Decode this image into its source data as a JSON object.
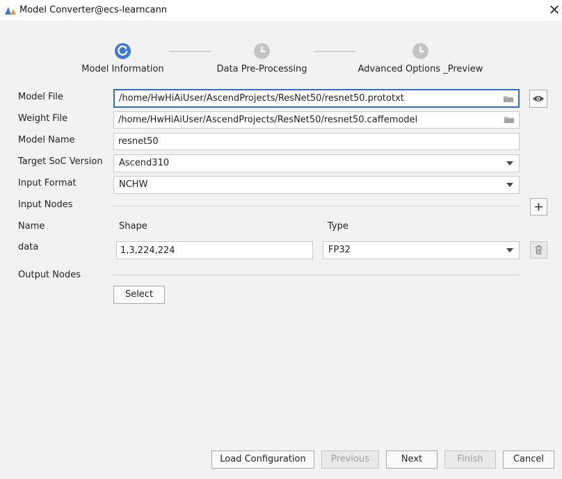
{
  "window": {
    "title": "Model Converter@ecs-learncann",
    "close_glyph": "✕"
  },
  "steps": [
    {
      "label": "Model Information",
      "state": "active"
    },
    {
      "label": "Data Pre-Processing",
      "state": "pending"
    },
    {
      "label": "Advanced Options _Preview",
      "state": "pending"
    }
  ],
  "form": {
    "model_file": {
      "label": "Model File",
      "value": "/home/HwHiAiUser/AscendProjects/ResNet50/resnet50.prototxt"
    },
    "weight_file": {
      "label": "Weight File",
      "value": "/home/HwHiAiUser/AscendProjects/ResNet50/resnet50.caffemodel"
    },
    "model_name": {
      "label": "Model Name",
      "value": "resnet50"
    },
    "target_soc": {
      "label": "Target SoC Version",
      "value": "Ascend310"
    },
    "input_format": {
      "label": "Input Format",
      "value": "NCHW"
    },
    "input_nodes": {
      "label": "Input Nodes",
      "columns": [
        "Name",
        "Shape",
        "Type"
      ],
      "rows": [
        {
          "name": "data",
          "shape": "1,3,224,224",
          "type": "FP32"
        }
      ]
    },
    "output_nodes": {
      "label": "Output Nodes",
      "select_label": "Select"
    }
  },
  "buttons": {
    "load_configuration": "Load Configuration",
    "previous": "Previous",
    "next": "Next",
    "finish": "Finish",
    "cancel": "Cancel"
  },
  "colors": {
    "accent": "#3c78d8",
    "step_pending": "#c4c4c4",
    "focus_border": "#2a6fc9"
  },
  "icons": [
    "app-icon",
    "close-icon",
    "folder-icon",
    "eye-icon",
    "plus-icon",
    "trash-icon",
    "dropdown-caret-icon",
    "spinner-icon",
    "clock-icon"
  ]
}
